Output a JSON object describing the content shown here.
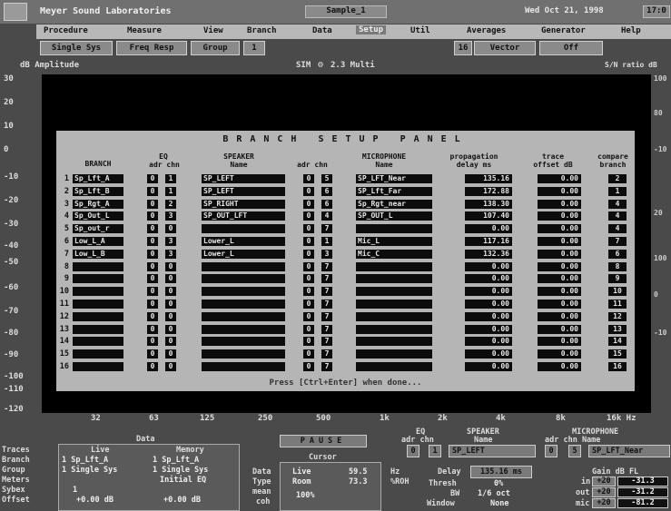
{
  "app": {
    "title": "Meyer Sound Laboratories",
    "document": "Sample_1",
    "datetime": "Wed Oct 21, 1998",
    "time": "17:0"
  },
  "menu": [
    "Procedure",
    "Measure",
    "View",
    "Branch",
    "Data",
    "Setup",
    "Util",
    "Averages",
    "Generator",
    "Help"
  ],
  "menu_selected": 5,
  "toolbar": {
    "single_sys": "Single Sys",
    "freq_resp": "Freq Resp",
    "group": "Group",
    "group_num": "1",
    "vector_num": "16",
    "vector": "Vector",
    "off": "Off"
  },
  "amp": {
    "label": "dB Amplitude",
    "sim": "SIM",
    "version": "2.3 Multi",
    "ratio": "S/N ratio dB"
  },
  "yaxis": [
    "30",
    "20",
    "10",
    "0",
    "-10",
    "-20",
    "-30",
    "-40",
    "-50",
    "-60",
    "-70",
    "-80",
    "-90",
    "-100",
    "-110",
    "-120"
  ],
  "yaxis_right": [
    "100",
    "80",
    "-10",
    "20",
    "100",
    "0",
    "-10"
  ],
  "xaxis": [
    "32",
    "63",
    "125",
    "250",
    "500",
    "1k",
    "2k",
    "4k",
    "8k",
    "16k Hz"
  ],
  "panel": {
    "title": "BRANCH SETUP PANEL",
    "headers": {
      "branch": "BRANCH",
      "eq": "EQ",
      "eq_sub": "adr chn",
      "speaker": "SPEAKER",
      "speaker_sub": "Name",
      "mic_adr": "adr chn",
      "microphone": "MICROPHONE",
      "mic_sub": "Name",
      "prop": "propagation",
      "prop_sub": "delay ms",
      "trace": "trace",
      "trace_sub": "offset dB",
      "compare": "compare",
      "compare_sub": "branch"
    },
    "rows": [
      {
        "n": "1",
        "branch": "Sp_Lft_A",
        "eqa": "0",
        "eqc": "1",
        "speaker": "SP_LEFT",
        "ma": "0",
        "mc": "5",
        "mic": "SP_LFT_Near",
        "delay": "135.16",
        "offset": "0.00",
        "cmp": "2"
      },
      {
        "n": "2",
        "branch": "Sp_Lft_B",
        "eqa": "0",
        "eqc": "1",
        "speaker": "SP_LEFT",
        "ma": "0",
        "mc": "6",
        "mic": "SP_Lft_Far",
        "delay": "172.88",
        "offset": "0.00",
        "cmp": "1"
      },
      {
        "n": "3",
        "branch": "Sp_Rgt_A",
        "eqa": "0",
        "eqc": "2",
        "speaker": "SP_RIGHT",
        "ma": "0",
        "mc": "6",
        "mic": "Sp_Rgt_near",
        "delay": "138.30",
        "offset": "0.00",
        "cmp": "4"
      },
      {
        "n": "4",
        "branch": "Sp_Out_L",
        "eqa": "0",
        "eqc": "3",
        "speaker": "SP_OUT_LFT",
        "ma": "0",
        "mc": "4",
        "mic": "SP_OUT_L",
        "delay": "107.40",
        "offset": "0.00",
        "cmp": "4"
      },
      {
        "n": "5",
        "branch": "Sp_out_r",
        "eqa": "0",
        "eqc": "0",
        "speaker": "",
        "ma": "0",
        "mc": "7",
        "mic": "",
        "delay": "0.00",
        "offset": "0.00",
        "cmp": "4"
      },
      {
        "n": "6",
        "branch": "Low_L_A",
        "eqa": "0",
        "eqc": "3",
        "speaker": "Lower_L",
        "ma": "0",
        "mc": "1",
        "mic": "Mic_L",
        "delay": "117.16",
        "offset": "0.00",
        "cmp": "7"
      },
      {
        "n": "7",
        "branch": "Low_L_B",
        "eqa": "0",
        "eqc": "3",
        "speaker": "Lower_L",
        "ma": "0",
        "mc": "3",
        "mic": "Mic_C",
        "delay": "132.36",
        "offset": "0.00",
        "cmp": "6"
      },
      {
        "n": "8",
        "branch": "",
        "eqa": "0",
        "eqc": "0",
        "speaker": "",
        "ma": "0",
        "mc": "7",
        "mic": "",
        "delay": "0.00",
        "offset": "0.00",
        "cmp": "8"
      },
      {
        "n": "9",
        "branch": "",
        "eqa": "0",
        "eqc": "0",
        "speaker": "",
        "ma": "0",
        "mc": "7",
        "mic": "",
        "delay": "0.00",
        "offset": "0.00",
        "cmp": "9"
      },
      {
        "n": "10",
        "branch": "",
        "eqa": "0",
        "eqc": "0",
        "speaker": "",
        "ma": "0",
        "mc": "7",
        "mic": "",
        "delay": "0.00",
        "offset": "0.00",
        "cmp": "10"
      },
      {
        "n": "11",
        "branch": "",
        "eqa": "0",
        "eqc": "0",
        "speaker": "",
        "ma": "0",
        "mc": "7",
        "mic": "",
        "delay": "0.00",
        "offset": "0.00",
        "cmp": "11"
      },
      {
        "n": "12",
        "branch": "",
        "eqa": "0",
        "eqc": "0",
        "speaker": "",
        "ma": "0",
        "mc": "7",
        "mic": "",
        "delay": "0.00",
        "offset": "0.00",
        "cmp": "12"
      },
      {
        "n": "13",
        "branch": "",
        "eqa": "0",
        "eqc": "0",
        "speaker": "",
        "ma": "0",
        "mc": "7",
        "mic": "",
        "delay": "0.00",
        "offset": "0.00",
        "cmp": "13"
      },
      {
        "n": "14",
        "branch": "",
        "eqa": "0",
        "eqc": "0",
        "speaker": "",
        "ma": "0",
        "mc": "7",
        "mic": "",
        "delay": "0.00",
        "offset": "0.00",
        "cmp": "14"
      },
      {
        "n": "15",
        "branch": "",
        "eqa": "0",
        "eqc": "0",
        "speaker": "",
        "ma": "0",
        "mc": "7",
        "mic": "",
        "delay": "0.00",
        "offset": "0.00",
        "cmp": "15"
      },
      {
        "n": "16",
        "branch": "",
        "eqa": "0",
        "eqc": "0",
        "speaker": "",
        "ma": "0",
        "mc": "7",
        "mic": "",
        "delay": "0.00",
        "offset": "0.00",
        "cmp": "16"
      }
    ],
    "prompt": "Press [Ctrl+Enter] when done..."
  },
  "bottom": {
    "data_label": "Data",
    "live": "Live",
    "memory": "Memory",
    "row_labels": [
      "Traces",
      "Branch",
      "Group",
      "Meters",
      "Sybex",
      "Offset"
    ],
    "live_branch": "1  Sp_Lft_A",
    "live_group": "1  Single Sys",
    "live_offset": "+0.00 dB",
    "live_meter": "1",
    "mem_branch": "1  Sp_Lft_A",
    "mem_group": "1  Single Sys",
    "mem_initial": "Initial EQ",
    "mem_offset": "+0.00 dB",
    "pause": "PAUSE",
    "cursor": "Cursor",
    "cursor_labels": [
      "Data",
      "Type",
      "mean",
      "coh"
    ],
    "cursor_type": "Live",
    "cursor_room": "Room",
    "cursor_100": "100%",
    "cursor_v1": "59.5",
    "cursor_v2": "73.3",
    "cursor_u1": "Hz",
    "cursor_u2": "%ROH",
    "eq": "EQ",
    "eq_sub": "adr chn",
    "eq_adr": "0",
    "eq_chn": "1",
    "speaker": "SPEAKER",
    "speaker_sub": "Name",
    "speaker_name": "SP_LEFT",
    "mic": "MICROPHONE",
    "mic_sub": "adr chn     Name",
    "mic_adr": "0",
    "mic_chn": "5",
    "mic_name": "SP_LFT_Near",
    "delay_label": "Delay",
    "delay_val": "135.16 ms",
    "thresh_label": "Thresh",
    "thresh_val": "0%",
    "bw_label": "BW",
    "bw_val": "1/6 oct",
    "window_label": "Window",
    "window_val": "None",
    "gain": "Gain dB FL",
    "gain_rows": [
      {
        "l": "in",
        "a": "+20",
        "b": "-31.3"
      },
      {
        "l": "out",
        "a": "+20",
        "b": "-31.2"
      },
      {
        "l": "mic",
        "a": "+20",
        "b": "-81.2"
      }
    ]
  }
}
